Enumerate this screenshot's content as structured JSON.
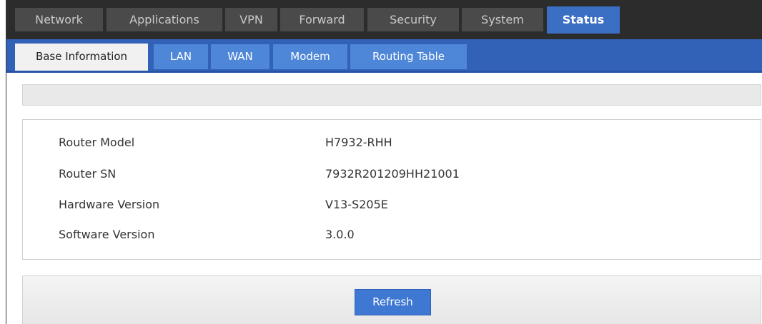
{
  "top_tabs": [
    {
      "label": "Network"
    },
    {
      "label": "Applications"
    },
    {
      "label": "VPN"
    },
    {
      "label": "Forward"
    },
    {
      "label": "Security"
    },
    {
      "label": "System"
    },
    {
      "label": "Status",
      "active": true
    }
  ],
  "sub_tabs": [
    {
      "label": "Base Information",
      "active": true
    },
    {
      "label": "LAN"
    },
    {
      "label": "WAN"
    },
    {
      "label": "Modem"
    },
    {
      "label": "Routing Table"
    }
  ],
  "info": [
    {
      "label": "Router Model",
      "value": "H7932-RHH"
    },
    {
      "label": "Router SN",
      "value": "7932R201209HH21001"
    },
    {
      "label": "Hardware Version",
      "value": "V13-S205E"
    },
    {
      "label": "Software Version",
      "value": "3.0.0"
    }
  ],
  "actions": {
    "refresh_label": "Refresh"
  },
  "colors": {
    "top_bar": "#2c2c2c",
    "active_tab": "#3a6fc4",
    "sub_bar": "#3262b8",
    "sub_tab": "#4e86d8"
  }
}
